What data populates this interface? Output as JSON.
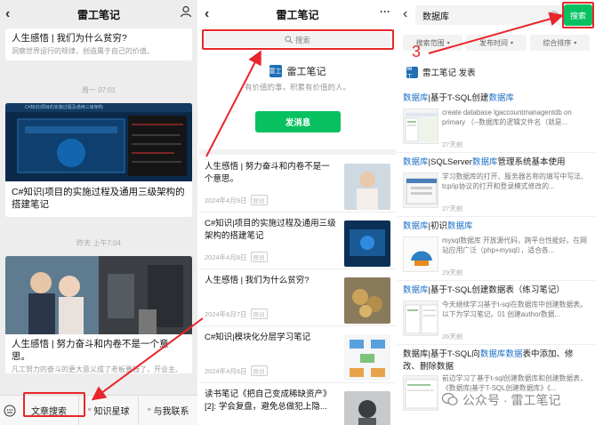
{
  "panel1": {
    "title": "雷工笔记",
    "back_glyph": "‹",
    "card1": {
      "title": "人生感悟 | 我们为什么贫穷?",
      "subtitle": "洞察世界运行的规律，创造属于自己的价值。"
    },
    "time1": "周一 07:01",
    "card2": {
      "title": "C#知识|项目的实施过程及通用三级架构的搭建笔记",
      "banner": "C#知识|项目的实施过程及通用三级架构"
    },
    "time2": "昨天 上午7:04",
    "card3": {
      "title": "人生感悟 | 努力奋斗和内卷不是一个意思。",
      "subtitle": "凡工努力的奋斗的更大意义成了老板要钱了，开业主、住豪宅、让自己收入没指高。"
    },
    "bottom": {
      "tab1": "文章搜索",
      "tab2": "知识星球",
      "tab3": "与我联系"
    }
  },
  "panel2": {
    "title": "雷工笔记",
    "more_glyph": "···",
    "search_placeholder": "搜索",
    "brand_name": "雷工笔记",
    "logo_text": "雷工",
    "slogan": "有价值的事，积累有价值的人。",
    "send_button": "发消息",
    "articles": [
      {
        "title": "人生感悟 | 努力奋斗和内卷不是一个意思。",
        "date": "2024年4月9日",
        "tag": "原创"
      },
      {
        "title": "C#知识|项目的实施过程及通用三级架构的搭建笔记",
        "date": "2024年4月8日",
        "tag": "原创"
      },
      {
        "title": "人生感悟 | 我们为什么贫穷?",
        "date": "2024年6月7日",
        "tag": "原创"
      },
      {
        "title": "C#知识|模块化分层学习笔记",
        "date": "2024年4月6日",
        "tag": "原创"
      },
      {
        "title": "读书笔记《把自己变成稀缺资产》[2]: 学会复盘，避免总做犯上隐...",
        "date": "2024年4月5日",
        "tag": ""
      }
    ]
  },
  "panel3": {
    "query": "数据库",
    "search_button": "搜索",
    "filters": [
      "搜索范围",
      "发布时间",
      "综合排序"
    ],
    "account": "雷工笔记 发表",
    "results": [
      {
        "title_parts": [
          "数据库",
          "|基于T-SQL创建",
          "数据库"
        ],
        "desc": "create database lgaccountmanagentdb on primary （--数据库的逻辑文件名（就是...",
        "time": "27天前"
      },
      {
        "title_parts": [
          "数据库",
          "|SQLServer",
          "数据库",
          "管理系统基本使用"
        ],
        "desc": "学习数据库的打开、服务器名称的填写中写法、tcp/ip协议的打开和登录模式修改的...",
        "time": "27天前"
      },
      {
        "title_parts": [
          "数据库",
          "|初识",
          "数据库"
        ],
        "desc": "mysql数据库 开放源代码，跨平台性能好。在网站应用广泛（php+mysql），适合各...",
        "time": "29天前"
      },
      {
        "title_parts": [
          "数据库",
          "|基于T-SQL创建数据表（练习笔记）"
        ],
        "desc": "今天继续学习基于t-sql在数据库中创建数据表。以下为学习笔记。01 创建author数据...",
        "time": "26天前"
      },
      {
        "title_parts": [
          "数据库|基于T-SQL向",
          "数据库",
          "数据",
          "表中添加、修改、删除数据"
        ],
        "desc": "前边学习了基于t-sql创建数据库和创建数据表，《数据库|基于T-SQL创建数据库》《...",
        "time": ""
      }
    ],
    "watermark": "公众号 · 雷工笔记"
  },
  "annotations": {
    "n1": "1",
    "n2": "2",
    "n3": "3"
  },
  "colors": {
    "accent_red": "#e8262b",
    "wechat_green": "#07c160",
    "link_blue": "#1e70c8"
  }
}
